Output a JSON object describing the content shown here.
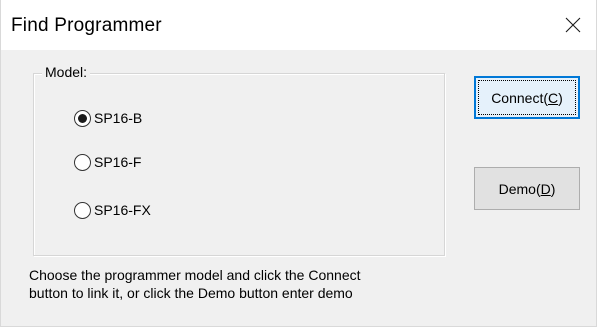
{
  "window": {
    "title": "Find Programmer",
    "close_icon": "close-icon"
  },
  "model_group": {
    "label": "Model:",
    "options": [
      {
        "label": "SP16-B",
        "selected": true
      },
      {
        "label": "SP16-F",
        "selected": false
      },
      {
        "label": "SP16-FX",
        "selected": false
      }
    ]
  },
  "buttons": {
    "connect": {
      "prefix": "Connect(",
      "mnemonic": "C",
      "suffix": ")",
      "is_default": true
    },
    "demo": {
      "prefix": "Demo(",
      "mnemonic": "D",
      "suffix": ")",
      "is_default": false
    }
  },
  "help": {
    "line1": "Choose the programmer model and click the Connect",
    "line2": "button to link it, or click the Demo button enter demo"
  },
  "colors": {
    "accent": "#0078d7",
    "dialog_bg": "#f0f0f0",
    "titlebar_bg": "#ffffff"
  }
}
